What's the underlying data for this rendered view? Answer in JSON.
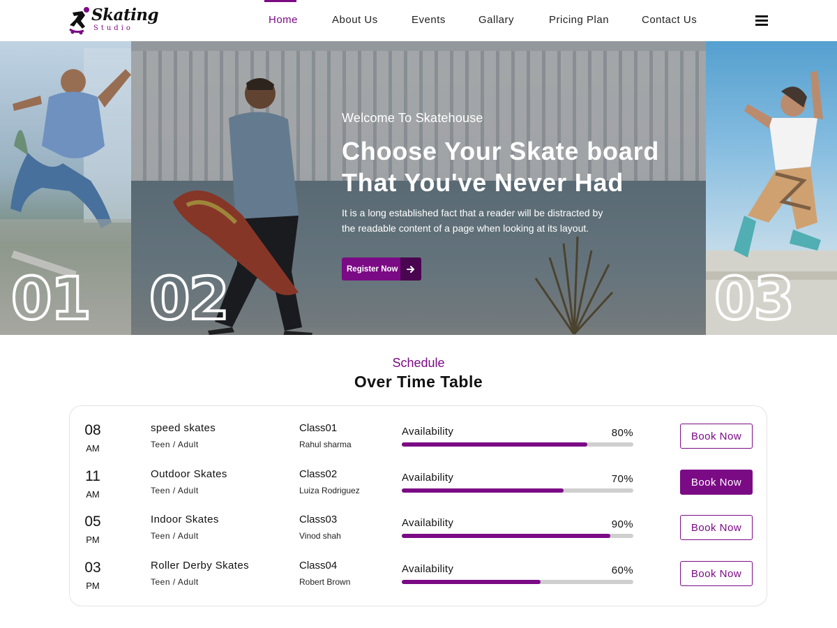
{
  "brand": {
    "name": "Skating",
    "sub": "Studio",
    "color": "#7b0a85"
  },
  "nav": {
    "items": [
      {
        "label": "Home",
        "active": true
      },
      {
        "label": "About Us"
      },
      {
        "label": "Events"
      },
      {
        "label": "Gallary"
      },
      {
        "label": "Pricing Plan"
      },
      {
        "label": "Contact Us"
      }
    ],
    "menu_icon": "hamburger-icon"
  },
  "hero": {
    "welcome": "Welcome To Skatehouse",
    "title_line1": "Choose Your Skate board",
    "title_line2": "That You've Never Had",
    "desc_line1": "It is a long established fact that a reader will be distracted by",
    "desc_line2": "the readable content of a page when looking at its layout.",
    "button_label": "Register Now",
    "button_icon": "arrow-right-icon",
    "slide_numbers": [
      "01",
      "02",
      "03"
    ]
  },
  "schedule": {
    "subtitle": "Schedule",
    "title": "Over Time Table",
    "avail_label": "Availability",
    "book_label": "Book Now",
    "rows": [
      {
        "time": "08",
        "ampm": "AM",
        "name": "speed skates",
        "audience": "Teen / Adult",
        "class": "Class01",
        "instructor": "Rahul sharma",
        "availability": 80,
        "availability_text": "80%",
        "highlighted": false
      },
      {
        "time": "11",
        "ampm": "AM",
        "name": "Outdoor Skates",
        "audience": "Teen / Adult",
        "class": "Class02",
        "instructor": "Luiza Rodriguez",
        "availability": 70,
        "availability_text": "70%",
        "highlighted": true
      },
      {
        "time": "05",
        "ampm": "PM",
        "name": "Indoor Skates",
        "audience": "Teen / Adult",
        "class": "Class03",
        "instructor": "Vinod shah",
        "availability": 90,
        "availability_text": "90%",
        "highlighted": false
      },
      {
        "time": "03",
        "ampm": "PM",
        "name": "Roller Derby Skates",
        "audience": "Teen / Adult",
        "class": "Class04",
        "instructor": "Robert Brown",
        "availability": 60,
        "availability_text": "60%",
        "highlighted": false
      }
    ]
  }
}
